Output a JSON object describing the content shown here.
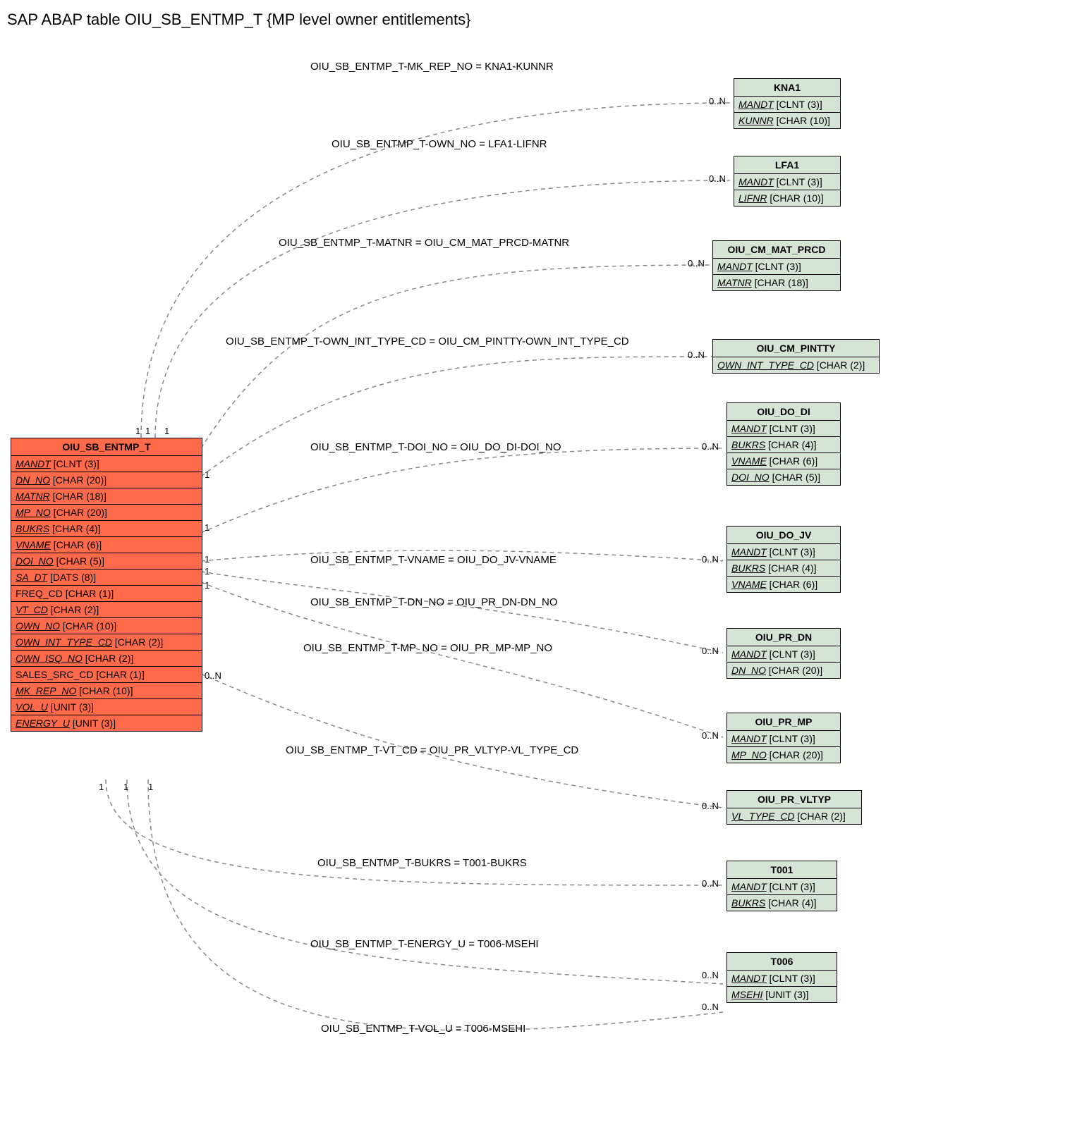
{
  "title": "SAP ABAP table OIU_SB_ENTMP_T {MP level owner entitlements}",
  "main_entity": {
    "name": "OIU_SB_ENTMP_T",
    "fields": [
      {
        "name": "MANDT",
        "type": "[CLNT (3)]",
        "u": true
      },
      {
        "name": "DN_NO",
        "type": "[CHAR (20)]",
        "u": true
      },
      {
        "name": "MATNR",
        "type": "[CHAR (18)]",
        "u": true
      },
      {
        "name": "MP_NO",
        "type": "[CHAR (20)]",
        "u": true
      },
      {
        "name": "BUKRS",
        "type": "[CHAR (4)]",
        "u": true
      },
      {
        "name": "VNAME",
        "type": "[CHAR (6)]",
        "u": true
      },
      {
        "name": "DOI_NO",
        "type": "[CHAR (5)]",
        "u": true
      },
      {
        "name": "SA_DT",
        "type": "[DATS (8)]",
        "u": true
      },
      {
        "name": "FREQ_CD",
        "type": "[CHAR (1)]",
        "u": false
      },
      {
        "name": "VT_CD",
        "type": "[CHAR (2)]",
        "u": true
      },
      {
        "name": "OWN_NO",
        "type": "[CHAR (10)]",
        "u": true
      },
      {
        "name": "OWN_INT_TYPE_CD",
        "type": "[CHAR (2)]",
        "u": true
      },
      {
        "name": "OWN_ISQ_NO",
        "type": "[CHAR (2)]",
        "u": true
      },
      {
        "name": "SALES_SRC_CD",
        "type": "[CHAR (1)]",
        "u": false
      },
      {
        "name": "MK_REP_NO",
        "type": "[CHAR (10)]",
        "u": true
      },
      {
        "name": "VOL_U",
        "type": "[UNIT (3)]",
        "u": true
      },
      {
        "name": "ENERGY_U",
        "type": "[UNIT (3)]",
        "u": true
      }
    ]
  },
  "related": [
    {
      "name": "KNA1",
      "fields": [
        {
          "name": "MANDT",
          "type": "[CLNT (3)]",
          "u": true
        },
        {
          "name": "KUNNR",
          "type": "[CHAR (10)]",
          "u": true
        }
      ]
    },
    {
      "name": "LFA1",
      "fields": [
        {
          "name": "MANDT",
          "type": "[CLNT (3)]",
          "u": true
        },
        {
          "name": "LIFNR",
          "type": "[CHAR (10)]",
          "u": true
        }
      ]
    },
    {
      "name": "OIU_CM_MAT_PRCD",
      "fields": [
        {
          "name": "MANDT",
          "type": "[CLNT (3)]",
          "u": true
        },
        {
          "name": "MATNR",
          "type": "[CHAR (18)]",
          "u": true
        }
      ]
    },
    {
      "name": "OIU_CM_PINTTY",
      "fields": [
        {
          "name": "OWN_INT_TYPE_CD",
          "type": "[CHAR (2)]",
          "u": true
        }
      ]
    },
    {
      "name": "OIU_DO_DI",
      "fields": [
        {
          "name": "MANDT",
          "type": "[CLNT (3)]",
          "u": true
        },
        {
          "name": "BUKRS",
          "type": "[CHAR (4)]",
          "u": true
        },
        {
          "name": "VNAME",
          "type": "[CHAR (6)]",
          "u": true
        },
        {
          "name": "DOI_NO",
          "type": "[CHAR (5)]",
          "u": true
        }
      ]
    },
    {
      "name": "OIU_DO_JV",
      "fields": [
        {
          "name": "MANDT",
          "type": "[CLNT (3)]",
          "u": true
        },
        {
          "name": "BUKRS",
          "type": "[CHAR (4)]",
          "u": true
        },
        {
          "name": "VNAME",
          "type": "[CHAR (6)]",
          "u": true
        }
      ]
    },
    {
      "name": "OIU_PR_DN",
      "fields": [
        {
          "name": "MANDT",
          "type": "[CLNT (3)]",
          "u": true
        },
        {
          "name": "DN_NO",
          "type": "[CHAR (20)]",
          "u": true
        }
      ]
    },
    {
      "name": "OIU_PR_MP",
      "fields": [
        {
          "name": "MANDT",
          "type": "[CLNT (3)]",
          "u": true
        },
        {
          "name": "MP_NO",
          "type": "[CHAR (20)]",
          "u": true
        }
      ]
    },
    {
      "name": "OIU_PR_VLTYP",
      "fields": [
        {
          "name": "VL_TYPE_CD",
          "type": "[CHAR (2)]",
          "u": true
        }
      ]
    },
    {
      "name": "T001",
      "fields": [
        {
          "name": "MANDT",
          "type": "[CLNT (3)]",
          "u": true
        },
        {
          "name": "BUKRS",
          "type": "[CHAR (4)]",
          "u": true
        }
      ]
    },
    {
      "name": "T006",
      "fields": [
        {
          "name": "MANDT",
          "type": "[CLNT (3)]",
          "u": true
        },
        {
          "name": "MSEHI",
          "type": "[UNIT (3)]",
          "u": true
        }
      ]
    }
  ],
  "relations": [
    {
      "label": "OIU_SB_ENTMP_T-MK_REP_NO = KNA1-KUNNR",
      "left": "1",
      "right": "0..N"
    },
    {
      "label": "OIU_SB_ENTMP_T-OWN_NO = LFA1-LIFNR",
      "left": "1",
      "right": "0..N"
    },
    {
      "label": "OIU_SB_ENTMP_T-MATNR = OIU_CM_MAT_PRCD-MATNR",
      "left": "1",
      "right": "0..N"
    },
    {
      "label": "OIU_SB_ENTMP_T-OWN_INT_TYPE_CD = OIU_CM_PINTTY-OWN_INT_TYPE_CD",
      "left": "1",
      "right": "0..N"
    },
    {
      "label": "OIU_SB_ENTMP_T-DOI_NO = OIU_DO_DI-DOI_NO",
      "left": "1",
      "right": "0..N"
    },
    {
      "label": "OIU_SB_ENTMP_T-VNAME = OIU_DO_JV-VNAME",
      "left": "1",
      "right": "0..N"
    },
    {
      "label": "OIU_SB_ENTMP_T-DN_NO = OIU_PR_DN-DN_NO",
      "left": "1",
      "right": "0..N"
    },
    {
      "label": "OIU_SB_ENTMP_T-MP_NO = OIU_PR_MP-MP_NO",
      "left": "1",
      "right": "0..N"
    },
    {
      "label": "OIU_SB_ENTMP_T-VT_CD = OIU_PR_VLTYP-VL_TYPE_CD",
      "left": "0..N",
      "right": "0..N"
    },
    {
      "label": "OIU_SB_ENTMP_T-BUKRS = T001-BUKRS",
      "left": "1",
      "right": "0..N"
    },
    {
      "label": "OIU_SB_ENTMP_T-ENERGY_U = T006-MSEHI",
      "left": "1",
      "right": "0..N"
    },
    {
      "label": "OIU_SB_ENTMP_T-VOL_U = T006-MSEHI",
      "left": "1",
      "right": "0..N"
    }
  ]
}
